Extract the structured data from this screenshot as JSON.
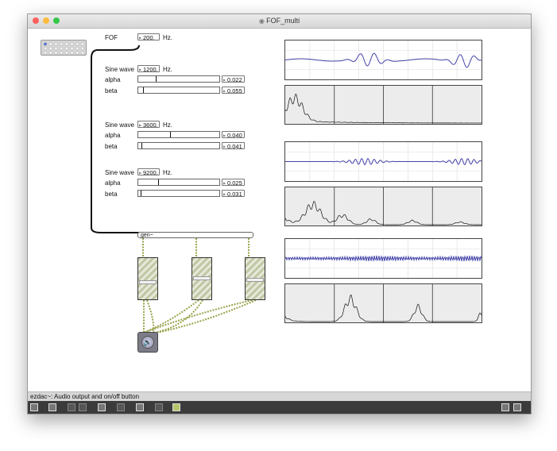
{
  "window": {
    "title": "FOF_multi",
    "traffic_lights": {
      "close": "#fc605b",
      "minimize": "#fdbc40",
      "zoom": "#34c84a"
    }
  },
  "fof": {
    "label": "FOF",
    "value": "200.",
    "unit": "Hz."
  },
  "sines": [
    {
      "label": "Sine wave",
      "freq": "1200.",
      "unit": "Hz.",
      "alpha_label": "alpha",
      "alpha_value": "0.022",
      "alpha_level": 0.22,
      "beta_label": "beta",
      "beta_value": "0.055",
      "beta_level": 0.055
    },
    {
      "label": "Sine wave",
      "freq": "3600.",
      "unit": "Hz.",
      "alpha_label": "alpha",
      "alpha_value": "0.040",
      "alpha_level": 0.4,
      "beta_label": "beta",
      "beta_value": "0.041",
      "beta_level": 0.041
    },
    {
      "label": "Sine wave",
      "freq": "9200.",
      "unit": "Hz.",
      "alpha_label": "alpha",
      "alpha_value": "0.025",
      "alpha_level": 0.25,
      "beta_label": "beta",
      "beta_value": "0.031",
      "beta_level": 0.031
    }
  ],
  "gen": {
    "label": "gen~"
  },
  "gains": [
    0.4,
    0.5,
    0.45
  ],
  "dac": {
    "icon": "speaker-icon"
  },
  "statusbar": {
    "text": "ezdac~: Audio output and on/off button"
  },
  "colors": {
    "waveform": "#4444aa",
    "cable": "#9aa24a",
    "toolbar": "#3b3b3b"
  }
}
